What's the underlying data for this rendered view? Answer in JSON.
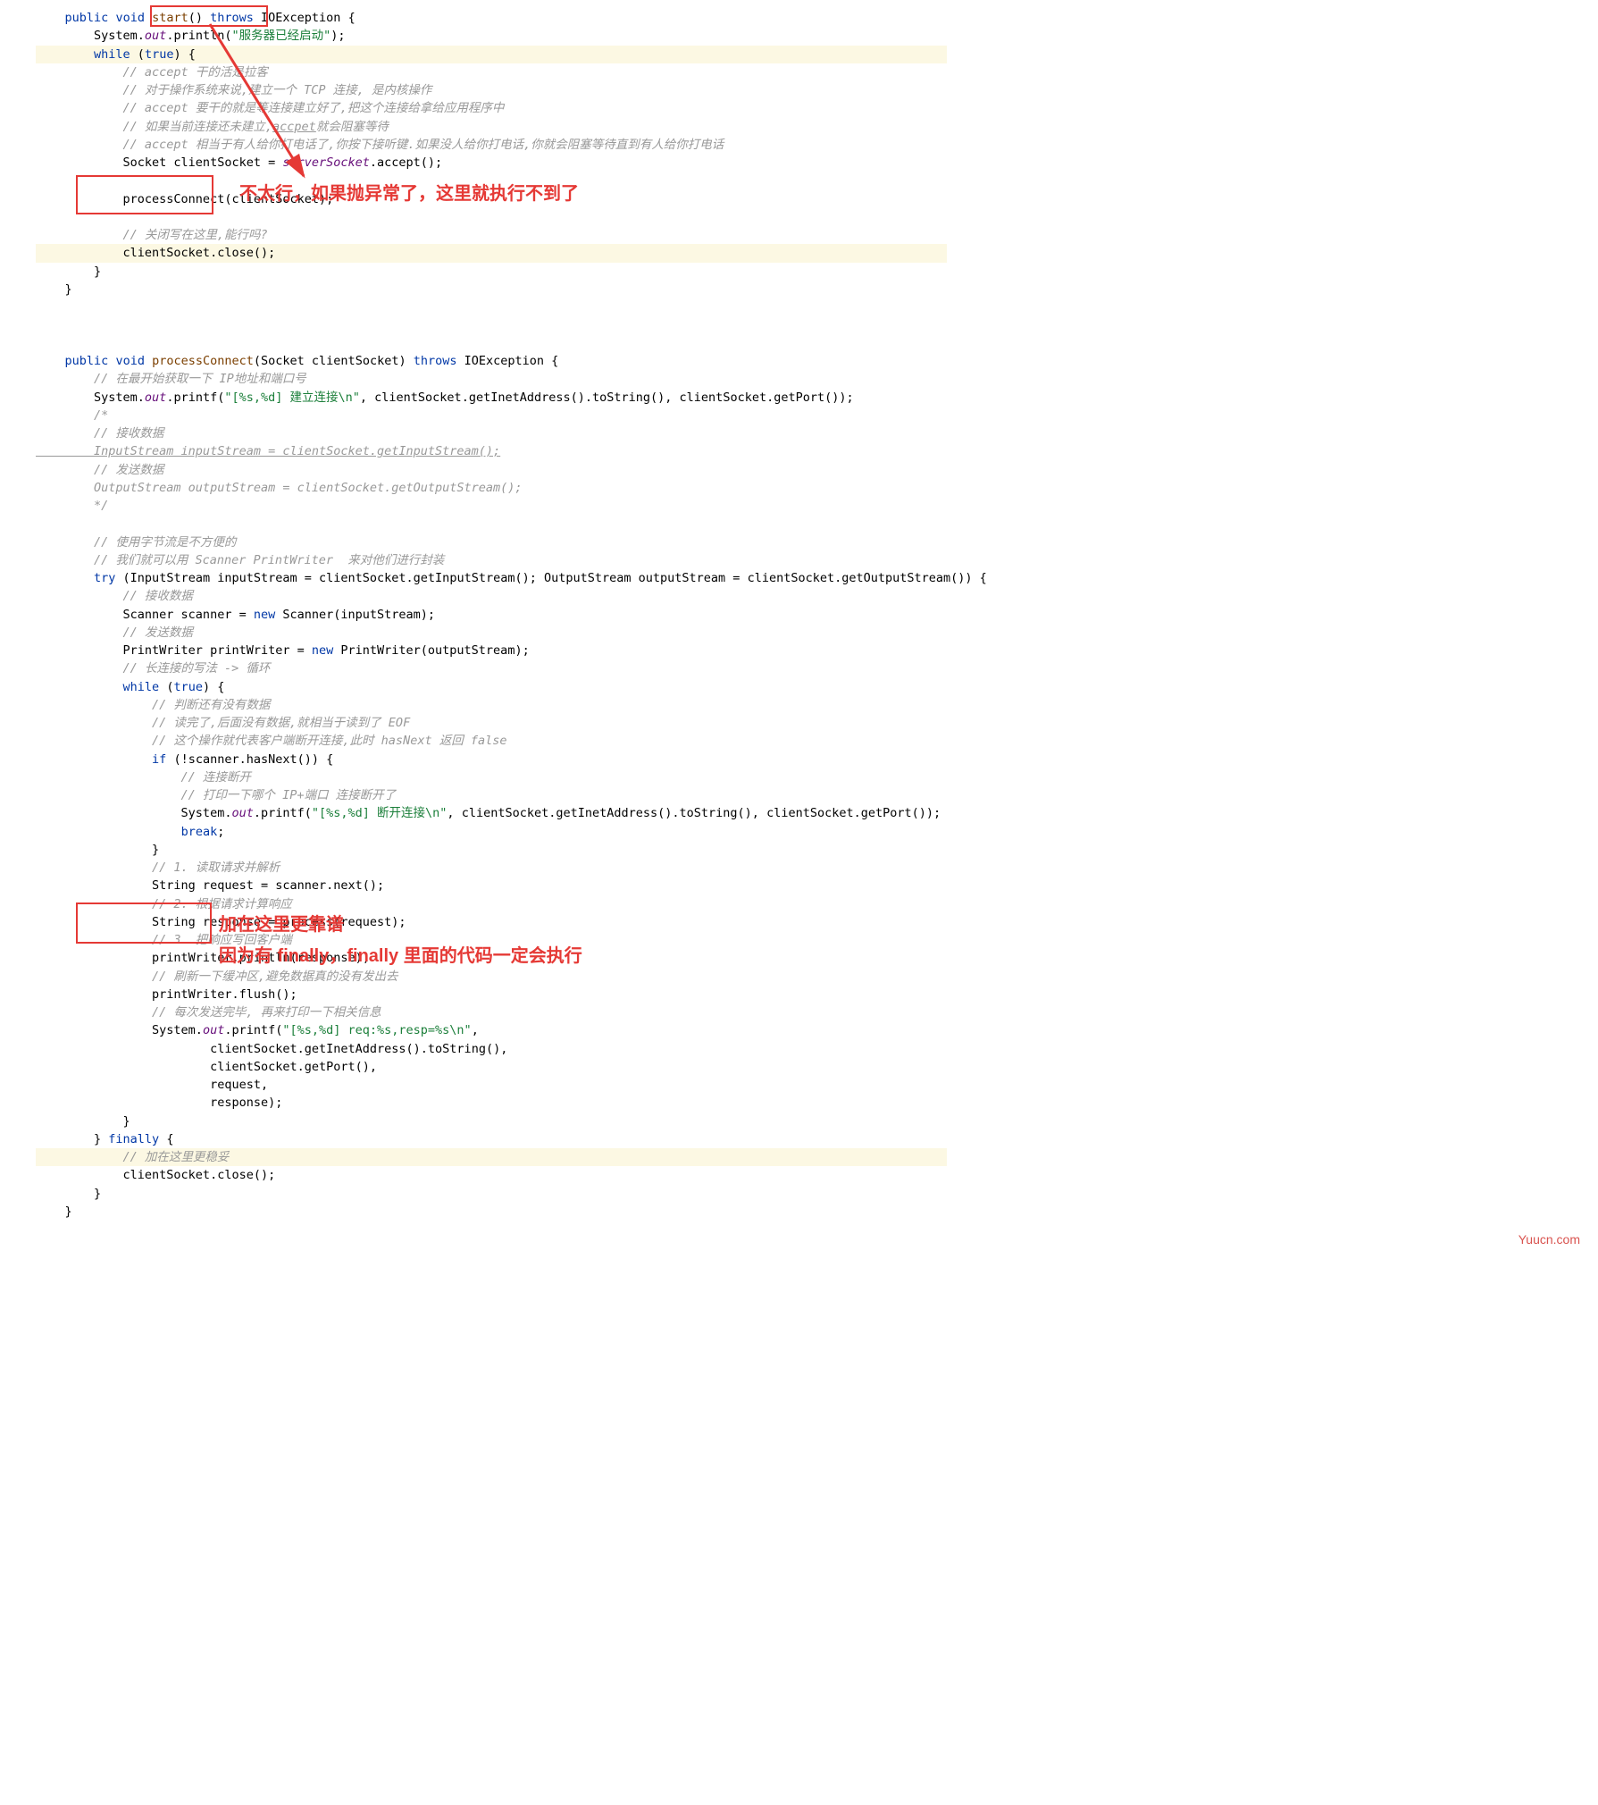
{
  "block1": {
    "l1": "    public void start() throws IOException {",
    "l2": "        System.out.println(\"服务器已经启动\");",
    "l3": "        while (true) {",
    "c1": "            // accept 干的活是拉客",
    "c2": "            // 对于操作系统来说,建立一个 TCP 连接, 是内核操作",
    "c3": "            // accept 要干的就是等连接建立好了,把这个连接给拿给应用程序中",
    "c4": "            // 如果当前连接还未建立,accpet就会阻塞等待",
    "c5": "            // accept 相当于有人给你打电话了,你按下接听键.如果没人给你打电话,你就会阻塞等待直到有人给你打电话",
    "l4": "            Socket clientSocket = serverSocket.accept();",
    "l5": "            processConnect(clientSocket);",
    "c6": "            // 关闭写在这里,能行吗?",
    "l6": "            clientSocket.close();",
    "l7": "        }",
    "l8": "    }"
  },
  "annotation1": "不太行，如果抛异常了，这里就执行不到了",
  "block2": {
    "l1": "    public void processConnect(Socket clientSocket) throws IOException {",
    "c1": "        // 在最开始获取一下 IP地址和端口号",
    "l2": "        System.out.printf(\"[%s,%d] 建立连接\\n\", clientSocket.getInetAddress().toString(), clientSocket.getPort());",
    "c2": "        /*",
    "c3": "        // 接收数据",
    "c4": "        InputStream inputStream = clientSocket.getInputStream();",
    "c5": "        // 发送数据",
    "c6": "        OutputStream outputStream = clientSocket.getOutputStream();",
    "c7": "        */",
    "c8": "        // 使用字节流是不方便的",
    "c9": "        // 我们就可以用 Scanner PrintWriter  来对他们进行封装",
    "l3": "        try (InputStream inputStream = clientSocket.getInputStream(); OutputStream outputStream = clientSocket.getOutputStream()) {",
    "c10": "            // 接收数据",
    "l4": "            Scanner scanner = new Scanner(inputStream);",
    "c11": "            // 发送数据",
    "l5": "            PrintWriter printWriter = new PrintWriter(outputStream);",
    "c12": "            // 长连接的写法 -> 循环",
    "l6": "            while (true) {",
    "c13": "                // 判断还有没有数据",
    "c14": "                // 读完了,后面没有数据,就相当于读到了 EOF",
    "c15": "                // 这个操作就代表客户端断开连接,此时 hasNext 返回 false",
    "l7": "                if (!scanner.hasNext()) {",
    "c16": "                    // 连接断开",
    "c17": "                    // 打印一下哪个 IP+端口 连接断开了",
    "l8": "                    System.out.printf(\"[%s,%d] 断开连接\\n\", clientSocket.getInetAddress().toString(), clientSocket.getPort());",
    "l9": "                    break;",
    "l10": "                }",
    "c18": "                // 1. 读取请求并解析",
    "l11": "                String request = scanner.next();",
    "c19": "                // 2. 根据请求计算响应",
    "l12": "                String response = process(request);",
    "c20": "                // 3. 把响应写回客户端",
    "l13": "                printWriter.println(response);",
    "c21": "                // 刷新一下缓冲区,避免数据真的没有发出去",
    "l14": "                printWriter.flush();",
    "c22": "                // 每次发送完毕, 再来打印一下相关信息",
    "l15": "                System.out.printf(\"[%s,%d] req:%s,resp=%s\\n\",",
    "l16": "                        clientSocket.getInetAddress().toString(),",
    "l17": "                        clientSocket.getPort(),",
    "l18": "                        request,",
    "l19": "                        response);",
    "l20": "            }",
    "l21": "        } finally {",
    "c23": "            // 加在这里更稳妥",
    "l22": "            clientSocket.close();",
    "l23": "        }",
    "l24": "    }"
  },
  "annotation2a": "加在这里更靠谱",
  "annotation2b": "因为有 finally，finally 里面的代码一定会执行",
  "watermark": "Yuucn.com"
}
